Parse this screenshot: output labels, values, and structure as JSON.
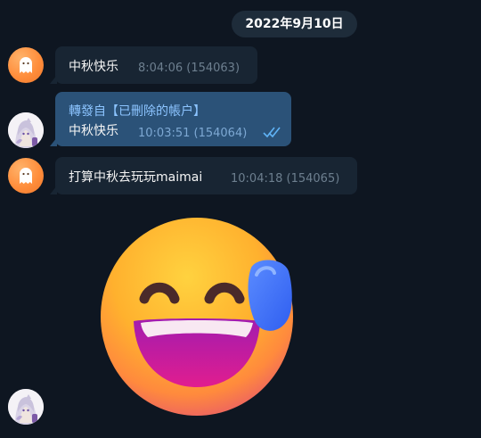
{
  "date_pill": "2022年9月10日",
  "messages": [
    {
      "text": "中秋快乐",
      "time": "8:04:06 (154063)"
    },
    {
      "forwarded_from": "轉發自【已刪除的帳户】",
      "text": "中秋快乐",
      "time": "10:03:51 (154064)",
      "status": "read"
    },
    {
      "text": "打算中秋去玩玩maimai",
      "time": "10:04:18 (154065)"
    }
  ],
  "avatars": {
    "incoming": "ghost-icon",
    "outgoing": "anime-avatar"
  },
  "sticker": "grinning-sweat-emoji",
  "colors": {
    "background": "#0e1621",
    "bubble_in": "#182533",
    "bubble_out": "#2b5278",
    "accent": "#5fb2f5"
  }
}
